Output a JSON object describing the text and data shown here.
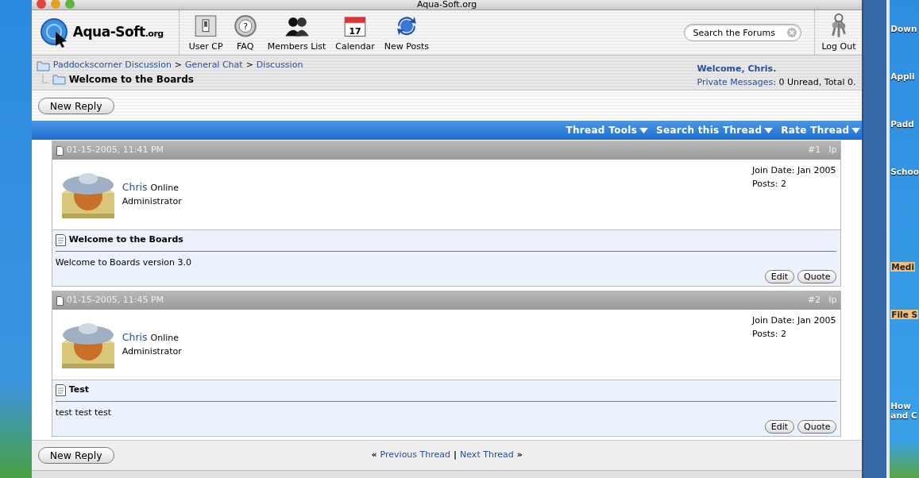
{
  "window": {
    "title": "Aqua-Soft.org"
  },
  "logo": {
    "name": "Aqua-Soft",
    "suffix": ".org"
  },
  "toolbar": [
    {
      "kind": "switch",
      "label": "User CP"
    },
    {
      "kind": "lifebuoy",
      "label": "FAQ",
      "glyph": "?"
    },
    {
      "kind": "people",
      "label": "Members List"
    },
    {
      "kind": "calendar",
      "label": "Calendar",
      "badge": "17"
    },
    {
      "kind": "sync",
      "label": "New Posts"
    }
  ],
  "search": {
    "placeholder": "Search the Forums"
  },
  "logout": {
    "label": "Log Out"
  },
  "breadcrumb": {
    "links": [
      "Paddockscorner Discussion",
      "General Chat",
      "Discussion"
    ],
    "separator": ">",
    "current": "Welcome to the Boards"
  },
  "welcome": {
    "greeting": "Welcome, Chris.",
    "pm_link": "Private Messages",
    "pm_text": ": 0 Unread, Total 0."
  },
  "new_reply_top": "New Reply",
  "thread_menus": [
    "Thread Tools",
    "Search this Thread",
    "Rate Thread"
  ],
  "posts": [
    {
      "date": "01-15-2005, 11:41 PM",
      "number": "#1",
      "extra": "Ip",
      "username": "Chris",
      "status": "Online",
      "role": "Administrator",
      "join_date": "Join Date: Jan 2005",
      "post_count": "Posts: 2",
      "subject": "Welcome to the Boards",
      "body": "Welcome to Boards version 3.0",
      "buttons": [
        "Edit",
        "Quote"
      ]
    },
    {
      "date": "01-15-2005, 11:45 PM",
      "number": "#2",
      "extra": "Ip",
      "username": "Chris",
      "status": "Online",
      "role": "Administrator",
      "join_date": "Join Date: Jan 2005",
      "post_count": "Posts: 2",
      "subject": "Test",
      "body": "test test test",
      "buttons": [
        "Edit",
        "Quote"
      ]
    }
  ],
  "footer": {
    "new_reply": "New Reply",
    "prev_mark": "«",
    "prev": "Previous Thread",
    "divider": "|",
    "next": "Next Thread",
    "next_mark": "»"
  },
  "desktop_labels": [
    {
      "text": "Down",
      "highlighted": false
    },
    {
      "text": "Appli",
      "highlighted": false
    },
    {
      "text": "Padd",
      "highlighted": false
    },
    {
      "text": "Schoo",
      "highlighted": false
    },
    {
      "text": "Medi",
      "highlighted": true
    },
    {
      "text": "File S",
      "highlighted": true
    },
    {
      "text": "How\nand C",
      "highlighted": false
    }
  ]
}
